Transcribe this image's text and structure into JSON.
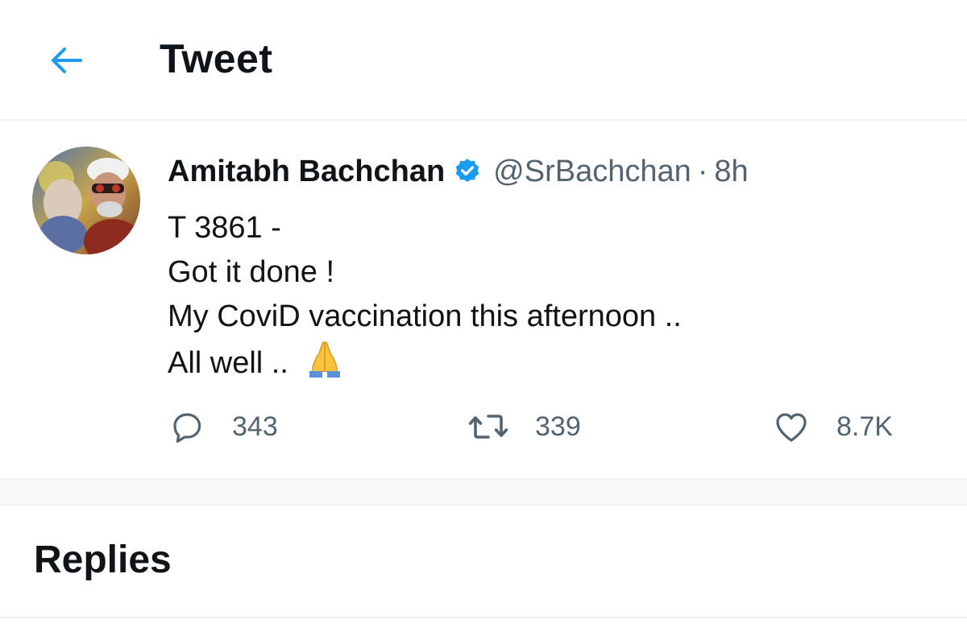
{
  "header": {
    "back_icon": "arrow-left-icon",
    "title": "Tweet"
  },
  "tweet": {
    "avatar": "avatar-photo",
    "author_name": "Amitabh Bachchan",
    "verified_icon": "verified-badge-icon",
    "handle": "@SrBachchan",
    "separator": "·",
    "time": "8h",
    "text_lines": [
      "T 3861 -",
      "Got it done !",
      "My CoviD vaccination this afternoon ..",
      "All well .."
    ],
    "emoji": "folded-hands-icon",
    "actions": {
      "reply_count": "343",
      "retweet_count": "339",
      "like_count": "8.7K"
    }
  },
  "replies": {
    "title": "Replies"
  },
  "colors": {
    "accent": "#1d9bf0",
    "secondary_text": "#536471",
    "divider": "#eff3f4"
  }
}
